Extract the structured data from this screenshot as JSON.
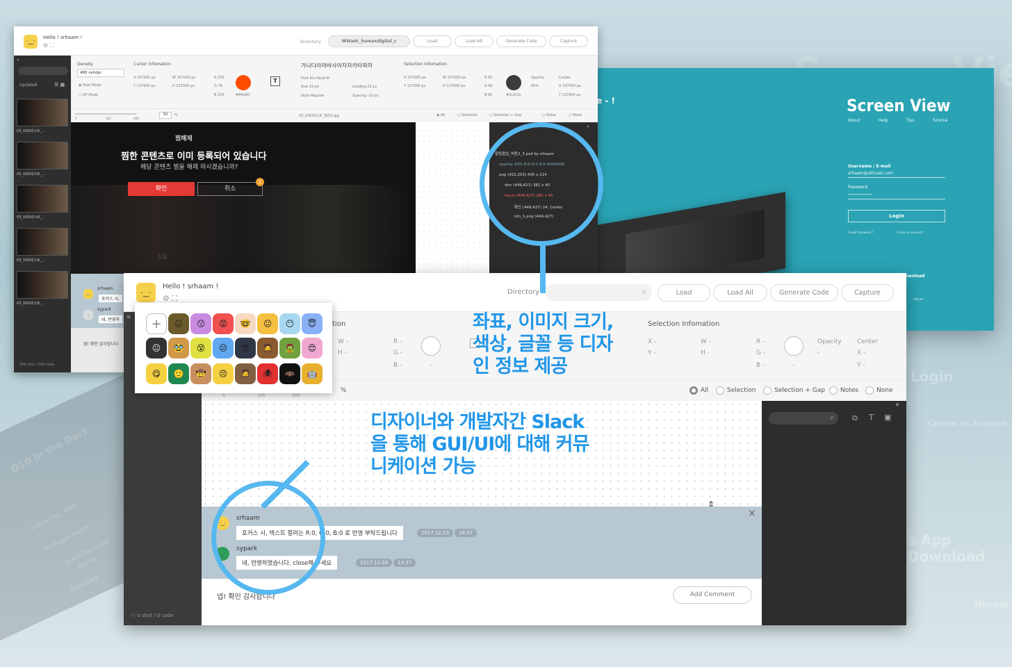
{
  "background": {
    "partial_title": "e  -  !",
    "bg_words": [
      "S",
      "Vie",
      "Login",
      "Create an Account !",
      "s App Download",
      "alticast",
      "D10 In the Dark",
      "Add to Fav. VOD",
      "Packages Name",
      "Retail Purchase",
      "Top Up",
      "Related"
    ]
  },
  "screen_view": {
    "title": "Screen View",
    "nav": [
      "About",
      "Help",
      "Tips",
      "Tutorial"
    ],
    "username_label": "Username / E-mail",
    "username_value": "srhaam@alticast.com",
    "password_label": "Password",
    "password_value": "••••••••••",
    "login_label": "Login",
    "forgot": "Forget Password ?",
    "create": "Create an Account !",
    "download": "ownload",
    "brand": "alticast"
  },
  "back_window": {
    "greeting": "Hello ! srhaam !",
    "directory_label": "Directory",
    "directory_value": "WWadc_humaxdigital_c",
    "buttons": [
      "Load",
      "Load All",
      "Generate Code",
      "Capture"
    ],
    "sidebar": {
      "sort": "Updated",
      "items": [
        "03_VOD리스트_...",
        "03_VOD리스트_...",
        "03_VOD리스트_...",
        "03_VOD리스트_...",
        "03_VOD리스트_..."
      ],
      "footer": "500 shot / 500 code"
    },
    "density": {
      "label": "Density",
      "value": "480 xxhdpi",
      "modes": [
        "Pixel Mode",
        "DP Mode"
      ],
      "zoom": "50",
      "zoom_unit": "%",
      "ticks": [
        "0",
        "100",
        "200"
      ]
    },
    "cursor": {
      "title": "Cursor Infomation",
      "x": "167000 px",
      "y": "137000 px",
      "w": "167000 px",
      "h": "137000 px",
      "r": "255",
      "g": "78",
      "b": "255",
      "hex": "#ff4e00"
    },
    "font": {
      "sample": "가나다라마바사아자차카타파하",
      "font_label": "Font",
      "font": "Rix Head M",
      "size_label": "Size",
      "size": "15 px",
      "style_label": "Style",
      "style": "Regular",
      "leading_label": "Leading",
      "leading": "22 px",
      "spacing_label": "Spacing",
      "spacing": "-10 px"
    },
    "selection": {
      "title": "Selection Infomation",
      "x": "167000 px",
      "y": "137000 px",
      "w": "167000 px",
      "h": "137000 px",
      "r": "60",
      "g": "60",
      "b": "60",
      "hex": "#3c3c3c",
      "opacity_label": "Opacity",
      "opacity": "60%",
      "center_label": "Center",
      "cx": "167000 px",
      "cy": "137000 px"
    },
    "filename": "03_VOD리스트_찜은2.jpg",
    "radios": [
      "All",
      "Selection",
      "Selection + Gap",
      "Notes",
      "None"
    ],
    "popup": {
      "title": "찜해제",
      "message": "찜한 콘텐츠로 이미 등록되어 있습니다",
      "sub": "해당 콘텐츠 찜을 해제 하시겠습니까?",
      "ok": "확인",
      "cancel": "취소",
      "badge": "1"
    },
    "layers": [
      "알림팝업_버튼2_3.psd by srhaam",
      "opacity 90%  R:0 G:0 B:0 #000000",
      "pop  (422,253)  435 x 214",
      "dim  (449,427)  382 x 40",
      "focus  (449,427)  382 x 40",
      "확인  (449,427)  24, Center",
      "btn_1.png  (449,427)"
    ],
    "chat": [
      {
        "name": "srhaam",
        "text": "포커스 시,"
      },
      {
        "name": "sypark",
        "text": "네, 반영하"
      }
    ],
    "comment_preview": "넵! 확인 감사합니다",
    "movie_titles": [
      "소림"
    ]
  },
  "front_window": {
    "greeting": "Hello ! srhaam !",
    "directory_label": "Directory",
    "buttons": [
      "Load",
      "Load All",
      "Generate Code",
      "Capture"
    ],
    "cursor_partial": "tion",
    "cursor_rows": [
      "W -",
      "H -",
      "R -",
      "G -",
      "B -",
      "-"
    ],
    "selection": {
      "title": "Selection Infomation",
      "x": "X -",
      "y": "Y -",
      "w": "W -",
      "h": "H -",
      "r": "R -",
      "g": "G -",
      "b": "B -",
      "dash": "-",
      "opacity_label": "Opacity",
      "opacity": "-",
      "center_label": "Center",
      "cx": "X -",
      "cy": "Y -"
    },
    "zoom_unit": "%",
    "ticks": [
      "0",
      "100",
      "200"
    ],
    "radios": [
      "All",
      "Selection",
      "Selection + Gap",
      "Notes",
      "None"
    ],
    "messages": [
      {
        "name": "srhaam",
        "text": "포커스 시, 텍스트 컬러는 R:0, G:0, B:0 로 반영 부탁드립니다",
        "date": "2017.12.23",
        "time": "18:37"
      },
      {
        "name": "sypark",
        "text": "네, 반영하였습니다. close해 주세요",
        "date": "2017.12.24",
        "time": "13:37"
      }
    ],
    "comment_input": "넵! 확인 감사합니다",
    "add_comment": "Add Comment",
    "footer": "0 shot / 0 code"
  },
  "emoji_picker": {
    "add": "+",
    "faces": [
      "😑",
      "😗",
      "😡",
      "🤓",
      "😐",
      "😶",
      "😇",
      "😐",
      "🥸",
      "😵",
      "😒",
      "😎",
      "🧔",
      "🧟",
      "😍",
      "😋",
      "🙂",
      "🤠",
      "😣",
      "🧔",
      "🕷",
      "🦇",
      "🤖"
    ]
  },
  "callouts": {
    "top": [
      "좌표, 이미지 크기,",
      "색상, 글꼴 등 디자",
      "인 정보 제공"
    ],
    "bottom": [
      "디자이너와 개발자간 Slack",
      "을 통해 GUI/UI에 대해 커뮤",
      "니케이션 가능"
    ]
  },
  "colors": {
    "accent": "#56b8ef",
    "callout_text": "#2196e8",
    "teal": "#2aa3b4",
    "red": "#e53935",
    "cursor_color": "#ff4e00",
    "selection_color": "#3c3c3c"
  }
}
